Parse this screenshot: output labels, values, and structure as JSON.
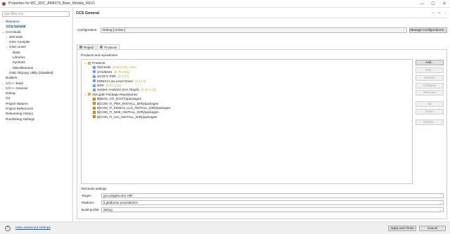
{
  "window": {
    "title": "Properties for MC_SDC_AM4379_Base_Module_REV1",
    "min": "—",
    "max": "☐",
    "close": "✕"
  },
  "sidebar": {
    "filter_placeholder": "type filter text",
    "items": [
      {
        "label": "Resource",
        "twisty": "›",
        "level": 0
      },
      {
        "label": "CCS General",
        "twisty": "",
        "level": 0,
        "selected": true
      },
      {
        "label": "CCS Build",
        "twisty": "⌄",
        "level": 0
      },
      {
        "label": "XDCtools",
        "twisty": "›",
        "level": 1
      },
      {
        "label": "GNU Compiler",
        "twisty": "›",
        "level": 1
      },
      {
        "label": "GNU Linker",
        "twisty": "⌄",
        "level": 1
      },
      {
        "label": "Basic",
        "twisty": "",
        "level": 2
      },
      {
        "label": "Libraries",
        "twisty": "",
        "level": 2
      },
      {
        "label": "Symbols",
        "twisty": "",
        "level": 2
      },
      {
        "label": "Miscellaneous",
        "twisty": "",
        "level": 2
      },
      {
        "label": "GNU Objcopy Utility  [Disabled]",
        "twisty": "",
        "level": 1
      },
      {
        "label": "Builders",
        "twisty": "",
        "level": 0
      },
      {
        "label": "C/C++ Build",
        "twisty": "›",
        "level": 0
      },
      {
        "label": "C/C++ General",
        "twisty": "›",
        "level": 0
      },
      {
        "label": "Debug",
        "twisty": "",
        "level": 0
      },
      {
        "label": "Git",
        "twisty": "",
        "level": 0
      },
      {
        "label": "Project Natures",
        "twisty": "",
        "level": 0
      },
      {
        "label": "Project References",
        "twisty": "",
        "level": 0
      },
      {
        "label": "Refactoring History",
        "twisty": "",
        "level": 0
      },
      {
        "label": "Run/Debug Settings",
        "twisty": "",
        "level": 0
      }
    ]
  },
  "main": {
    "title": "CCS General",
    "nav_icons": [
      "back-arrow-icon",
      "forward-arrow-icon",
      "menu-icon"
    ],
    "configuration_label": "Configuration:",
    "configuration_value": "Debug  [ Active ]",
    "manage_button": "Manage Configurations...",
    "tabs": [
      {
        "label": "Project"
      },
      {
        "label": "Products",
        "active": true
      }
    ],
    "products_label": "Products and repositories",
    "tree": [
      {
        "label": "Products",
        "version": "",
        "type": "folder",
        "level": 0,
        "twisty": "⌄"
      },
      {
        "label": "XDCtools",
        "version": "[3.61.0.16_core]",
        "type": "prod",
        "level": 1
      },
      {
        "label": "SYS/BIOS",
        "version": "[6.76.3.01]",
        "type": "prod",
        "level": 1
      },
      {
        "label": "am437x PDK",
        "version": "[1.0.17]",
        "type": "prod",
        "level": 1
      },
      {
        "label": "EDMA3 Low Level Driver",
        "version": "[2.12.5]",
        "type": "prod",
        "level": 1
      },
      {
        "label": "NDK",
        "version": "[3.61.1.01]",
        "type": "prod",
        "level": 1
      },
      {
        "label": "System Analyzer (UIA Target)",
        "version": "[2.30.1.02]",
        "type": "prod",
        "level": 1
      },
      {
        "label": "XDCpath Package Repositories",
        "version": "",
        "type": "folder",
        "level": 0,
        "twisty": "⌄"
      },
      {
        "label": "$(BIOS_CG_ROOT)/packages",
        "version": "",
        "type": "repo",
        "level": 1
      },
      {
        "label": "${COM_TI_PDK_INSTALL_DIR}/packages",
        "version": "",
        "type": "repo",
        "level": 1
      },
      {
        "label": "${COM_TI_EDMA3_LLD_INSTALL_DIR}/packages",
        "version": "",
        "type": "repo",
        "level": 1
      },
      {
        "label": "${COM_TI_NDK_INSTALL_DIR}/packages",
        "version": "",
        "type": "repo",
        "level": 1
      },
      {
        "label": "${COM_TI_UIA_INSTALL_DIR}/packages",
        "version": "",
        "type": "repo",
        "level": 1
      }
    ],
    "side_buttons": [
      {
        "label": "Add...",
        "enabled": true
      },
      {
        "label": "Edit...",
        "enabled": false
      },
      {
        "label": "Expand",
        "enabled": false
      },
      {
        "label": "Collapse",
        "enabled": false
      },
      {
        "label": "Remove",
        "enabled": false
      },
      {
        "label": "Up",
        "enabled": false
      },
      {
        "label": "Down",
        "enabled": false
      },
      {
        "label": "Details...",
        "enabled": false
      }
    ],
    "settings_label": "XDCtools settings",
    "fields": [
      {
        "label": "Target:",
        "value": "gnu.targets.arm.A9F",
        "dropdown": false
      },
      {
        "label": "Platform:",
        "value": "ti.platforms.evmAM437x",
        "dropdown": true
      },
      {
        "label": "Build-profile:",
        "value": "debug",
        "dropdown": true
      }
    ]
  },
  "footer": {
    "help": "?",
    "advanced_link": "Hide advanced settings",
    "apply_close": "Apply and Close",
    "cancel": "Cancel"
  }
}
